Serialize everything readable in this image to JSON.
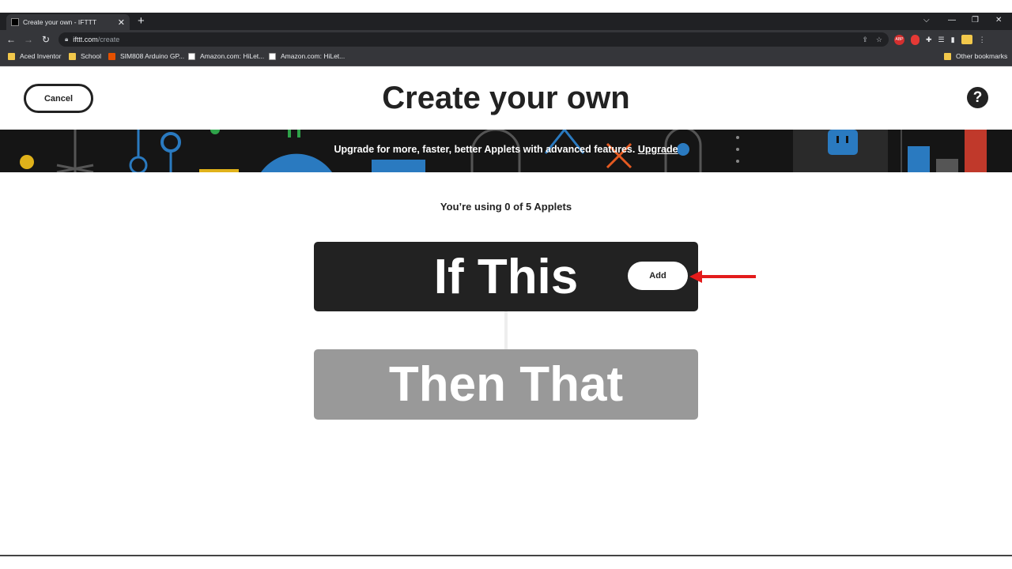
{
  "browser": {
    "tab_title": "Create your own - IFTTT",
    "tab_close": "✕",
    "new_tab": "+",
    "window_controls": {
      "dropdown": "⌵",
      "minimize": "—",
      "restore": "❐",
      "close": "✕"
    },
    "nav": {
      "back": "←",
      "forward": "→",
      "reload": "↻"
    },
    "url_host": "ifttt.com",
    "url_path": "/create",
    "bookmarks": [
      {
        "label": "Aced Inventor",
        "icon": "folder-icon"
      },
      {
        "label": "School",
        "icon": "folder-icon"
      },
      {
        "label": "SIM808 Arduino GP...",
        "icon": "sim808-icon"
      },
      {
        "label": "Amazon.com: HiLet...",
        "icon": "amazon-icon"
      },
      {
        "label": "Amazon.com: HiLet...",
        "icon": "amazon-icon"
      }
    ],
    "other_bookmarks": "Other bookmarks",
    "abp_label": "ABP"
  },
  "header": {
    "cancel_label": "Cancel",
    "title": "Create your own",
    "help_label": "?"
  },
  "banner": {
    "text": "Upgrade for more, faster, better Applets with advanced features.",
    "link": "Upgrade"
  },
  "usage_text": "You’re using 0 of 5 Applets",
  "if_this": {
    "label": "If This",
    "add_label": "Add"
  },
  "then_that": {
    "label": "Then That"
  },
  "colors": {
    "dark": "#222222",
    "disabled": "#999999",
    "annotation_arrow": "#e31b1b"
  }
}
